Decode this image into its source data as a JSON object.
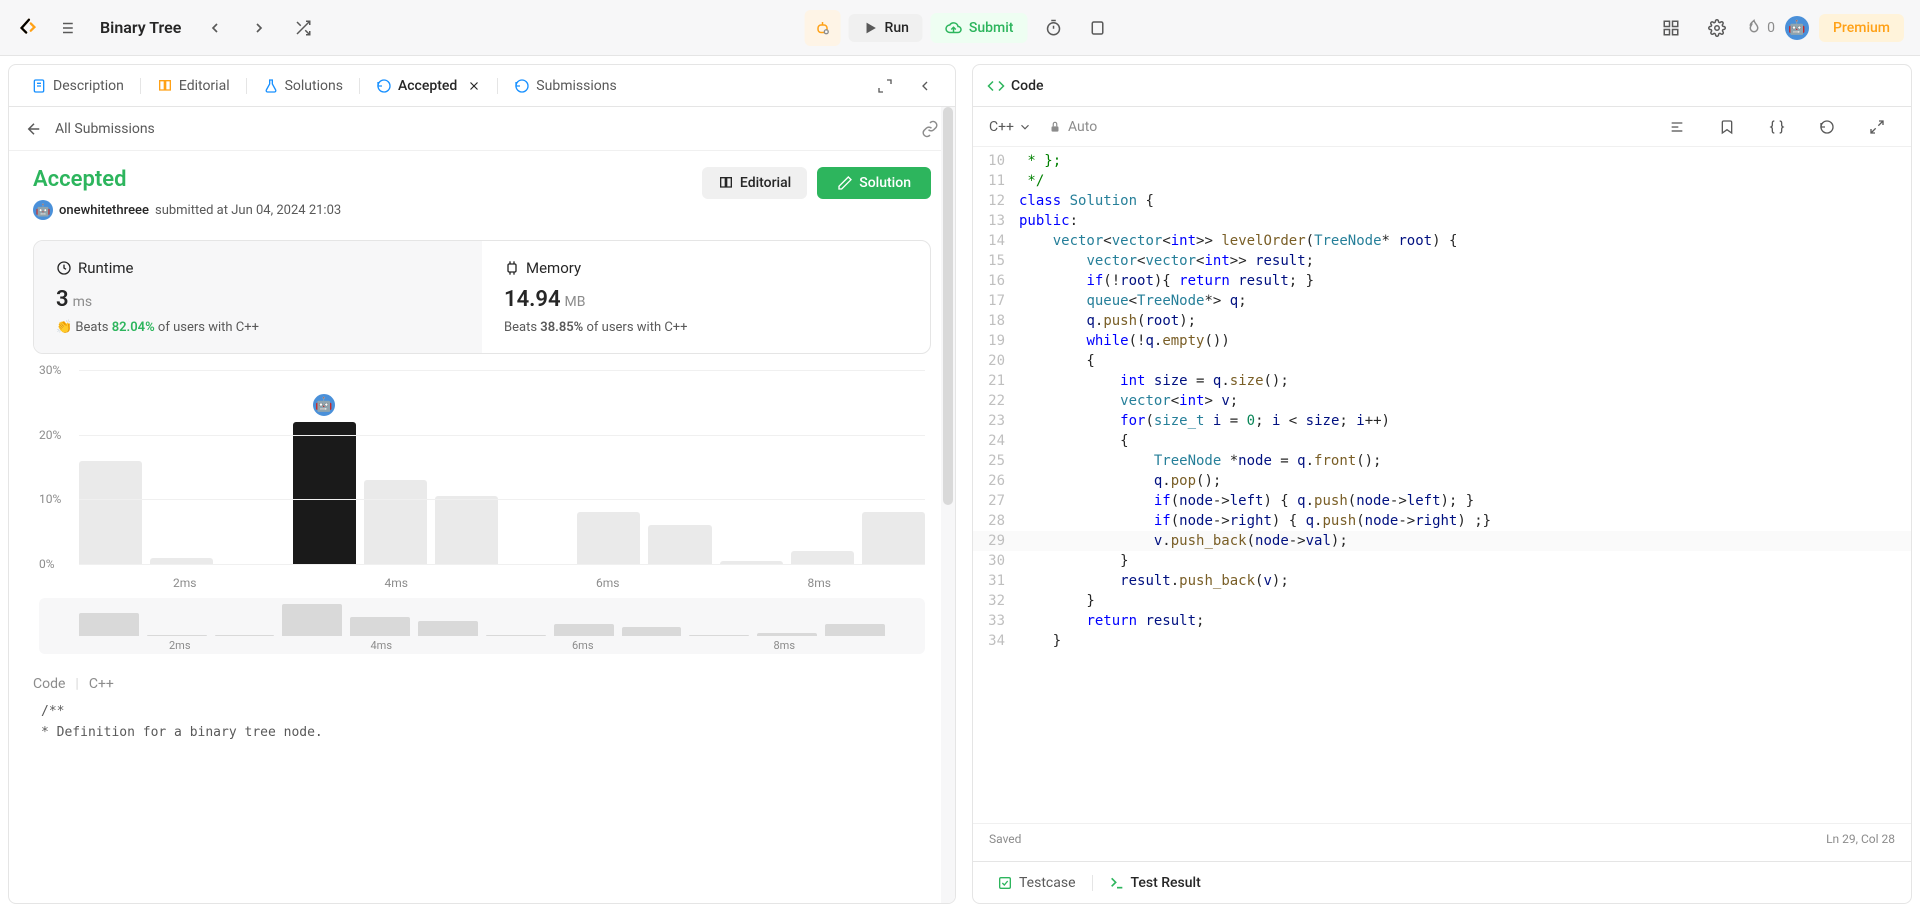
{
  "topbar": {
    "problem_title": "Binary Tree",
    "run_label": "Run",
    "submit_label": "Submit",
    "streak_count": "0",
    "premium_label": "Premium"
  },
  "left_tabs": {
    "description": "Description",
    "editorial": "Editorial",
    "solutions": "Solutions",
    "accepted": "Accepted",
    "submissions": "Submissions"
  },
  "subbar": {
    "all_submissions": "All Submissions"
  },
  "result": {
    "status": "Accepted",
    "username": "onewhitethreee",
    "submitted_at": "submitted at Jun 04, 2024 21:03",
    "editorial_btn": "Editorial",
    "solution_btn": "Solution"
  },
  "runtime": {
    "label": "Runtime",
    "value": "3",
    "unit": "ms",
    "beats_prefix": "Beats",
    "beats_pct": "82.04%",
    "beats_suffix": "of users with C++"
  },
  "memory": {
    "label": "Memory",
    "value": "14.94",
    "unit": "MB",
    "beats_prefix": "Beats",
    "beats_pct": "38.85%",
    "beats_suffix": "of users with C++"
  },
  "chart_data": {
    "type": "bar",
    "title": "Runtime distribution",
    "xlabel": "ms",
    "ylabel": "%",
    "ylim": [
      0,
      30
    ],
    "yticks": [
      "0%",
      "10%",
      "20%",
      "30%"
    ],
    "xticks": [
      "2ms",
      "4ms",
      "6ms",
      "8ms"
    ],
    "mini_xticks": [
      "2ms",
      "4ms",
      "6ms",
      "8ms"
    ],
    "values": [
      16,
      1,
      0,
      22,
      13,
      10.5,
      0,
      8,
      6,
      0.5,
      2,
      8
    ],
    "highlight_index": 3,
    "mini_values": [
      16,
      1,
      0,
      22,
      13,
      10.5,
      0,
      8,
      6,
      0.5,
      2,
      8
    ]
  },
  "code_section": {
    "label": "Code",
    "lang": "C++"
  },
  "snippet_lines": [
    "/**",
    " * Definition for a binary tree node."
  ],
  "code_panel": {
    "title": "Code",
    "language": "C++",
    "auto": "Auto",
    "saved": "Saved",
    "cursor": "Ln 29, Col 28"
  },
  "editor_lines": [
    {
      "n": 10,
      "tokens": [
        [
          "comment",
          " * };"
        ]
      ]
    },
    {
      "n": 11,
      "tokens": [
        [
          "comment",
          " */"
        ]
      ]
    },
    {
      "n": 12,
      "tokens": [
        [
          "kw",
          "class"
        ],
        [
          "punct",
          " "
        ],
        [
          "type",
          "Solution"
        ],
        [
          "punct",
          " {"
        ]
      ]
    },
    {
      "n": 13,
      "tokens": [
        [
          "kw",
          "public"
        ],
        [
          "punct",
          ":"
        ]
      ]
    },
    {
      "n": 14,
      "tokens": [
        [
          "punct",
          "    "
        ],
        [
          "type",
          "vector"
        ],
        [
          "punct",
          "<"
        ],
        [
          "type",
          "vector"
        ],
        [
          "punct",
          "<"
        ],
        [
          "kw",
          "int"
        ],
        [
          "punct",
          ">> "
        ],
        [
          "func",
          "levelOrder"
        ],
        [
          "punct",
          "("
        ],
        [
          "type",
          "TreeNode"
        ],
        [
          "punct",
          "* "
        ],
        [
          "ident",
          "root"
        ],
        [
          "punct",
          ") {"
        ]
      ]
    },
    {
      "n": 15,
      "tokens": [
        [
          "punct",
          "        "
        ],
        [
          "type",
          "vector"
        ],
        [
          "punct",
          "<"
        ],
        [
          "type",
          "vector"
        ],
        [
          "punct",
          "<"
        ],
        [
          "kw",
          "int"
        ],
        [
          "punct",
          ">> "
        ],
        [
          "ident",
          "result"
        ],
        [
          "punct",
          ";"
        ]
      ]
    },
    {
      "n": 16,
      "tokens": [
        [
          "punct",
          "        "
        ],
        [
          "kw",
          "if"
        ],
        [
          "punct",
          "(!"
        ],
        [
          "ident",
          "root"
        ],
        [
          "punct",
          "){ "
        ],
        [
          "kw",
          "return"
        ],
        [
          "punct",
          " "
        ],
        [
          "ident",
          "result"
        ],
        [
          "punct",
          "; }"
        ]
      ]
    },
    {
      "n": 17,
      "tokens": [
        [
          "punct",
          "        "
        ],
        [
          "type",
          "queue"
        ],
        [
          "punct",
          "<"
        ],
        [
          "type",
          "TreeNode"
        ],
        [
          "punct",
          "*> "
        ],
        [
          "ident",
          "q"
        ],
        [
          "punct",
          ";"
        ]
      ]
    },
    {
      "n": 18,
      "tokens": [
        [
          "punct",
          "        "
        ],
        [
          "ident",
          "q"
        ],
        [
          "punct",
          "."
        ],
        [
          "func",
          "push"
        ],
        [
          "punct",
          "("
        ],
        [
          "ident",
          "root"
        ],
        [
          "punct",
          ");"
        ]
      ]
    },
    {
      "n": 19,
      "tokens": [
        [
          "punct",
          "        "
        ],
        [
          "kw",
          "while"
        ],
        [
          "punct",
          "(!"
        ],
        [
          "ident",
          "q"
        ],
        [
          "punct",
          "."
        ],
        [
          "func",
          "empty"
        ],
        [
          "punct",
          "())"
        ]
      ]
    },
    {
      "n": 20,
      "tokens": [
        [
          "punct",
          "        {"
        ]
      ]
    },
    {
      "n": 21,
      "tokens": [
        [
          "punct",
          "            "
        ],
        [
          "kw",
          "int"
        ],
        [
          "punct",
          " "
        ],
        [
          "ident",
          "size"
        ],
        [
          "punct",
          " = "
        ],
        [
          "ident",
          "q"
        ],
        [
          "punct",
          "."
        ],
        [
          "func",
          "size"
        ],
        [
          "punct",
          "();"
        ]
      ]
    },
    {
      "n": 22,
      "tokens": [
        [
          "punct",
          "            "
        ],
        [
          "type",
          "vector"
        ],
        [
          "punct",
          "<"
        ],
        [
          "kw",
          "int"
        ],
        [
          "punct",
          "> "
        ],
        [
          "ident",
          "v"
        ],
        [
          "punct",
          ";"
        ]
      ]
    },
    {
      "n": 23,
      "tokens": [
        [
          "punct",
          "            "
        ],
        [
          "kw",
          "for"
        ],
        [
          "punct",
          "("
        ],
        [
          "type",
          "size_t"
        ],
        [
          "punct",
          " "
        ],
        [
          "ident",
          "i"
        ],
        [
          "punct",
          " = "
        ],
        [
          "num",
          "0"
        ],
        [
          "punct",
          "; "
        ],
        [
          "ident",
          "i"
        ],
        [
          "punct",
          " < "
        ],
        [
          "ident",
          "size"
        ],
        [
          "punct",
          "; "
        ],
        [
          "ident",
          "i"
        ],
        [
          "punct",
          "++)"
        ]
      ]
    },
    {
      "n": 24,
      "tokens": [
        [
          "punct",
          "            {"
        ]
      ]
    },
    {
      "n": 25,
      "tokens": [
        [
          "punct",
          "                "
        ],
        [
          "type",
          "TreeNode"
        ],
        [
          "punct",
          " *"
        ],
        [
          "ident",
          "node"
        ],
        [
          "punct",
          " = "
        ],
        [
          "ident",
          "q"
        ],
        [
          "punct",
          "."
        ],
        [
          "func",
          "front"
        ],
        [
          "punct",
          "();"
        ]
      ]
    },
    {
      "n": 26,
      "tokens": [
        [
          "punct",
          "                "
        ],
        [
          "ident",
          "q"
        ],
        [
          "punct",
          "."
        ],
        [
          "func",
          "pop"
        ],
        [
          "punct",
          "();"
        ]
      ]
    },
    {
      "n": 27,
      "tokens": [
        [
          "punct",
          "                "
        ],
        [
          "kw",
          "if"
        ],
        [
          "punct",
          "("
        ],
        [
          "ident",
          "node"
        ],
        [
          "punct",
          "->"
        ],
        [
          "ident",
          "left"
        ],
        [
          "punct",
          ") { "
        ],
        [
          "ident",
          "q"
        ],
        [
          "punct",
          "."
        ],
        [
          "func",
          "push"
        ],
        [
          "punct",
          "("
        ],
        [
          "ident",
          "node"
        ],
        [
          "punct",
          "->"
        ],
        [
          "ident",
          "left"
        ],
        [
          "punct",
          "); }"
        ]
      ]
    },
    {
      "n": 28,
      "tokens": [
        [
          "punct",
          "                "
        ],
        [
          "kw",
          "if"
        ],
        [
          "punct",
          "("
        ],
        [
          "ident",
          "node"
        ],
        [
          "punct",
          "->"
        ],
        [
          "ident",
          "right"
        ],
        [
          "punct",
          ") { "
        ],
        [
          "ident",
          "q"
        ],
        [
          "punct",
          "."
        ],
        [
          "func",
          "push"
        ],
        [
          "punct",
          "("
        ],
        [
          "ident",
          "node"
        ],
        [
          "punct",
          "->"
        ],
        [
          "ident",
          "right"
        ],
        [
          "punct",
          ") ;}"
        ]
      ]
    },
    {
      "n": 29,
      "hl": true,
      "tokens": [
        [
          "punct",
          "                "
        ],
        [
          "ident",
          "v"
        ],
        [
          "punct",
          "."
        ],
        [
          "func",
          "push_back"
        ],
        [
          "punct",
          "("
        ],
        [
          "ident",
          "node"
        ],
        [
          "punct",
          "->"
        ],
        [
          "ident",
          "val"
        ],
        [
          "punct",
          ");"
        ]
      ]
    },
    {
      "n": 30,
      "tokens": [
        [
          "punct",
          "            }"
        ]
      ]
    },
    {
      "n": 31,
      "tokens": [
        [
          "punct",
          "            "
        ],
        [
          "ident",
          "result"
        ],
        [
          "punct",
          "."
        ],
        [
          "func",
          "push_back"
        ],
        [
          "punct",
          "("
        ],
        [
          "ident",
          "v"
        ],
        [
          "punct",
          ");"
        ]
      ]
    },
    {
      "n": 32,
      "tokens": [
        [
          "punct",
          "        }"
        ]
      ]
    },
    {
      "n": 33,
      "tokens": [
        [
          "punct",
          "        "
        ],
        [
          "kw",
          "return"
        ],
        [
          "punct",
          " "
        ],
        [
          "ident",
          "result"
        ],
        [
          "punct",
          ";"
        ]
      ]
    },
    {
      "n": 34,
      "tokens": [
        [
          "punct",
          "    }"
        ]
      ]
    }
  ],
  "bottom_tabs": {
    "testcase": "Testcase",
    "test_result": "Test Result"
  }
}
